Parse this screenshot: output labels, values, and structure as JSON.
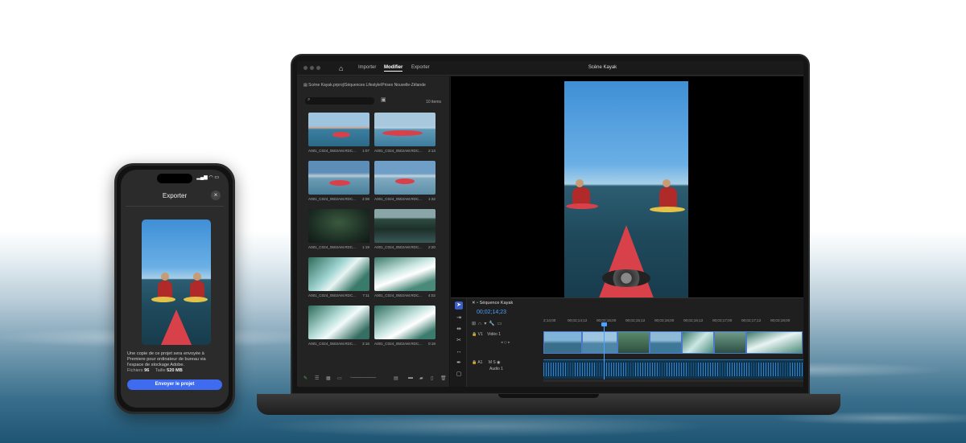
{
  "phone": {
    "time": "",
    "title": "Exporter",
    "close_glyph": "×",
    "description": "Une copie de ce projet sera envoyée à Premiere pour ordinateur de bureau via l'espace de stockage Adobe.",
    "files_label": "Fichiers",
    "files_value": "96",
    "size_label": "Taille",
    "size_value": "520 MB",
    "send_button": "Envoyer le projet"
  },
  "app": {
    "nav": {
      "home_icon": "home-icon",
      "tabs": [
        {
          "label": "Importer",
          "active": false
        },
        {
          "label": "Modifier",
          "active": true
        },
        {
          "label": "Exporter",
          "active": false
        }
      ]
    },
    "window_title": "Scène Kayak",
    "project_path": "Scène Kayak.prproj\\Séquences Lifestyle\\Prises Nouvelle-Zélande",
    "item_count": "10 items",
    "clips": [
      {
        "name": "A001_C024_0502AM.RDC...",
        "duration": "1:07"
      },
      {
        "name": "A001_C024_0502AM.RDC...",
        "duration": "2:13"
      },
      {
        "name": "A001_C024_0502AM.RDC...",
        "duration": "2:08"
      },
      {
        "name": "A001_C024_0502AM.RDC...",
        "duration": "1:32"
      },
      {
        "name": "A001_C024_0502AM.RDC...",
        "duration": "1:19"
      },
      {
        "name": "A001_C024_0502AM.RDC...",
        "duration": "2:20"
      },
      {
        "name": "A001_C024_0502AM.RDC...",
        "duration": "7:11"
      },
      {
        "name": "A001_C024_0502AM.RDC...",
        "duration": "4:02"
      },
      {
        "name": "A001_C024_0502AM.RDC...",
        "duration": "3:16"
      },
      {
        "name": "A001_C024_0502AM.RDC...",
        "duration": "0:18"
      }
    ],
    "timeline": {
      "sequence_name": "Séquence Kayak",
      "timecode": "00;02;14;23",
      "ruler": [
        "2;14;00",
        "00;02;14;12",
        "00;02;15;00",
        "00;02;15;12",
        "00;02;16;00",
        "00;02;16;12",
        "00;02;17;00",
        "00;02;17;12",
        "00;02;18;00"
      ],
      "video_track": {
        "id": "V1",
        "name": "Vidéo 1"
      },
      "audio_track": {
        "id": "A1",
        "name": "Audio 1"
      }
    }
  }
}
